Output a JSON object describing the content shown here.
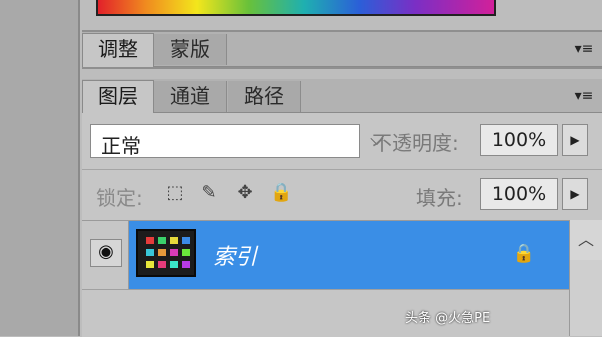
{
  "panels": {
    "adjust_tabs": [
      {
        "label": "调整",
        "active": true
      },
      {
        "label": "蒙版",
        "active": false
      }
    ],
    "layers_tabs": [
      {
        "label": "图层",
        "active": true
      },
      {
        "label": "通道",
        "active": false
      },
      {
        "label": "路径",
        "active": false
      }
    ],
    "menu_icon": "panel-menu-icon"
  },
  "layers": {
    "blend_mode": "正常",
    "opacity_label": "不透明度:",
    "opacity_value": "100%",
    "lock_label": "锁定:",
    "fill_label": "填充:",
    "fill_value": "100%",
    "layer_name": "索引",
    "selected_color": "#3a8ee6"
  },
  "watermark": "头条 @火急PE"
}
